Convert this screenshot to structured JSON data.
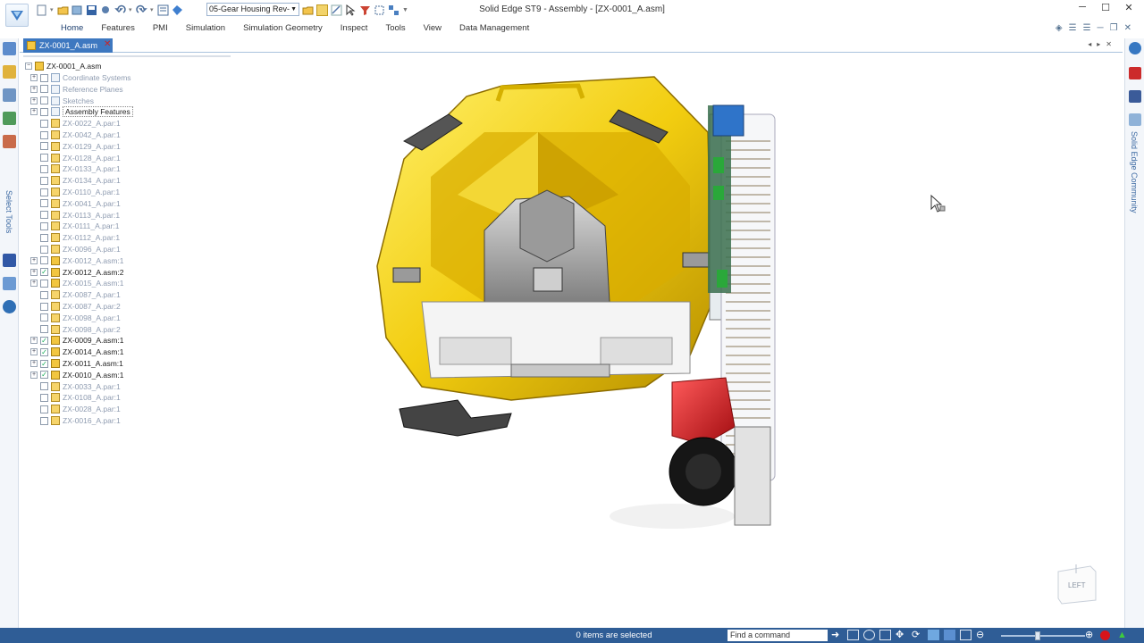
{
  "window": {
    "title": "Solid Edge ST9 - Assembly - [ZX-0001_A.asm]",
    "controls": [
      "minimize",
      "maximize",
      "close"
    ]
  },
  "quick_access": {
    "document_select_value": "05-Gear Housing Rev-"
  },
  "ribbon": {
    "tabs": [
      "Home",
      "Features",
      "PMI",
      "Simulation",
      "Simulation Geometry",
      "Inspect",
      "Tools",
      "View",
      "Data Management"
    ],
    "active_tab": "Home"
  },
  "document_tab": {
    "label": "ZX-0001_A.asm",
    "close_glyph": "✕"
  },
  "left_dock": {
    "select_tools_label": "Select Tools"
  },
  "right_dock": {
    "community_label": "Solid Edge Community"
  },
  "pathfinder": {
    "root": "ZX-0001_A.asm",
    "items": [
      {
        "label": "Coordinate Systems",
        "checked": false,
        "expander": "+",
        "kind": "feature",
        "dim": true,
        "boxed": false
      },
      {
        "label": "Reference Planes",
        "checked": false,
        "expander": "+",
        "kind": "feature",
        "dim": true,
        "boxed": false
      },
      {
        "label": "Sketches",
        "checked": false,
        "expander": "+",
        "kind": "feature",
        "dim": true,
        "boxed": false
      },
      {
        "label": "Assembly Features",
        "checked": false,
        "expander": "+",
        "kind": "feature",
        "dim": false,
        "boxed": true
      },
      {
        "label": "ZX-0022_A.par:1",
        "checked": false,
        "expander": "",
        "kind": "part",
        "dim": true,
        "boxed": false
      },
      {
        "label": "ZX-0042_A.par:1",
        "checked": false,
        "expander": "",
        "kind": "part",
        "dim": true,
        "boxed": false
      },
      {
        "label": "ZX-0129_A.par:1",
        "checked": false,
        "expander": "",
        "kind": "part",
        "dim": true,
        "boxed": false
      },
      {
        "label": "ZX-0128_A.par:1",
        "checked": false,
        "expander": "",
        "kind": "part",
        "dim": true,
        "boxed": false
      },
      {
        "label": "ZX-0133_A.par:1",
        "checked": false,
        "expander": "",
        "kind": "part",
        "dim": true,
        "boxed": false
      },
      {
        "label": "ZX-0134_A.par:1",
        "checked": false,
        "expander": "",
        "kind": "part",
        "dim": true,
        "boxed": false
      },
      {
        "label": "ZX-0110_A.par:1",
        "checked": false,
        "expander": "",
        "kind": "part",
        "dim": true,
        "boxed": false
      },
      {
        "label": "ZX-0041_A.par:1",
        "checked": false,
        "expander": "",
        "kind": "part",
        "dim": true,
        "boxed": false
      },
      {
        "label": "ZX-0113_A.par:1",
        "checked": false,
        "expander": "",
        "kind": "part",
        "dim": true,
        "boxed": false
      },
      {
        "label": "ZX-0111_A.par:1",
        "checked": false,
        "expander": "",
        "kind": "part",
        "dim": true,
        "boxed": false
      },
      {
        "label": "ZX-0112_A.par:1",
        "checked": false,
        "expander": "",
        "kind": "part",
        "dim": true,
        "boxed": false
      },
      {
        "label": "ZX-0096_A.par:1",
        "checked": false,
        "expander": "",
        "kind": "part",
        "dim": true,
        "boxed": false
      },
      {
        "label": "ZX-0012_A.asm:1",
        "checked": false,
        "expander": "+",
        "kind": "asm",
        "dim": true,
        "boxed": false
      },
      {
        "label": "ZX-0012_A.asm:2",
        "checked": true,
        "expander": "+",
        "kind": "asm",
        "dim": false,
        "boxed": false
      },
      {
        "label": "ZX-0015_A.asm:1",
        "checked": false,
        "expander": "+",
        "kind": "asm",
        "dim": true,
        "boxed": false
      },
      {
        "label": "ZX-0087_A.par:1",
        "checked": false,
        "expander": "",
        "kind": "part",
        "dim": true,
        "boxed": false
      },
      {
        "label": "ZX-0087_A.par:2",
        "checked": false,
        "expander": "",
        "kind": "part",
        "dim": true,
        "boxed": false
      },
      {
        "label": "ZX-0098_A.par:1",
        "checked": false,
        "expander": "",
        "kind": "part",
        "dim": true,
        "boxed": false
      },
      {
        "label": "ZX-0098_A.par:2",
        "checked": false,
        "expander": "",
        "kind": "part",
        "dim": true,
        "boxed": false
      },
      {
        "label": "ZX-0009_A.asm:1",
        "checked": true,
        "expander": "+",
        "kind": "asm",
        "dim": false,
        "boxed": false
      },
      {
        "label": "ZX-0014_A.asm:1",
        "checked": true,
        "expander": "+",
        "kind": "asm",
        "dim": false,
        "boxed": false
      },
      {
        "label": "ZX-0011_A.asm:1",
        "checked": true,
        "expander": "+",
        "kind": "asm",
        "dim": false,
        "boxed": false
      },
      {
        "label": "ZX-0010_A.asm:1",
        "checked": true,
        "expander": "+",
        "kind": "asm",
        "dim": false,
        "boxed": false
      },
      {
        "label": "ZX-0033_A.par:1",
        "checked": false,
        "expander": "",
        "kind": "part",
        "dim": true,
        "boxed": false
      },
      {
        "label": "ZX-0108_A.par:1",
        "checked": false,
        "expander": "",
        "kind": "part",
        "dim": true,
        "boxed": false
      },
      {
        "label": "ZX-0028_A.par:1",
        "checked": false,
        "expander": "",
        "kind": "part",
        "dim": true,
        "boxed": false
      },
      {
        "label": "ZX-0016_A.par:1",
        "checked": false,
        "expander": "",
        "kind": "part",
        "dim": true,
        "boxed": false
      }
    ]
  },
  "viewport": {
    "view_cube_label": "LEFT"
  },
  "status_bar": {
    "selection_text": "0 items are selected",
    "find_command_placeholder": "Find a command"
  },
  "colors": {
    "accent": "#2f5d96",
    "doc_tab": "#3e78c0",
    "housing_yellow": "#f2cd10",
    "motor_red": "#d8141b",
    "board_green": "#2aa83a"
  }
}
